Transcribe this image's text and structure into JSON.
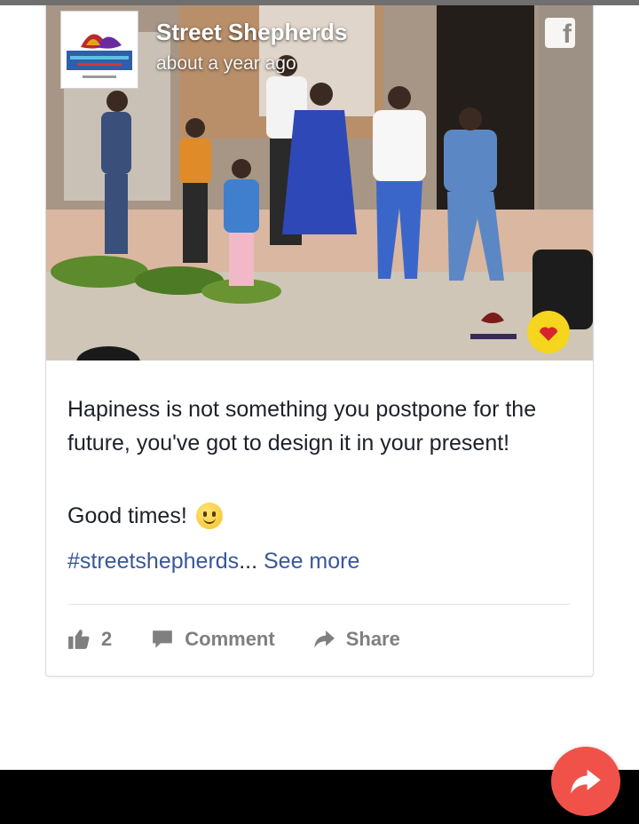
{
  "post": {
    "page_name": "Street Shepherds",
    "time": "about a year ago",
    "text_main": "Hapiness is not something you postpone for the future, you've got to design it in your present!",
    "text_second": "Good times!",
    "hashtag": "#streetshepherds",
    "ellipsis": "...",
    "see_more": "See more"
  },
  "actions": {
    "like_count": "2",
    "comment_label": "Comment",
    "share_label": "Share"
  },
  "icons": {
    "facebook": "facebook-icon",
    "like": "thumbs-up-icon",
    "comment": "comment-icon",
    "share": "share-arrow-icon",
    "fab": "share-fab-icon"
  },
  "colors": {
    "link": "#385898",
    "fab": "#f0524a",
    "action_gray": "#7f7f7f"
  }
}
